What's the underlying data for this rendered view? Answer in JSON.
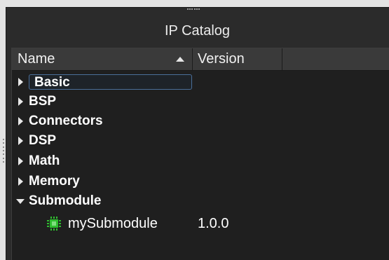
{
  "panel": {
    "title": "IP Catalog"
  },
  "columns": {
    "name": "Name",
    "version": "Version"
  },
  "tree": {
    "items": [
      {
        "label": "Basic",
        "expanded": false,
        "selected": true
      },
      {
        "label": "BSP",
        "expanded": false
      },
      {
        "label": "Connectors",
        "expanded": false
      },
      {
        "label": "DSP",
        "expanded": false
      },
      {
        "label": "Math",
        "expanded": false
      },
      {
        "label": "Memory",
        "expanded": false
      },
      {
        "label": "Submodule",
        "expanded": true
      }
    ],
    "child": {
      "name": "mySubmodule",
      "version": "1.0.0",
      "icon": "chip-icon",
      "icon_color": "#2fbf2f"
    }
  },
  "colors": {
    "panel_bg": "#2b2b2b",
    "tree_bg": "#1f1f1f",
    "header_bg": "#3a3a3a",
    "selection_border": "#4a6f9a"
  }
}
